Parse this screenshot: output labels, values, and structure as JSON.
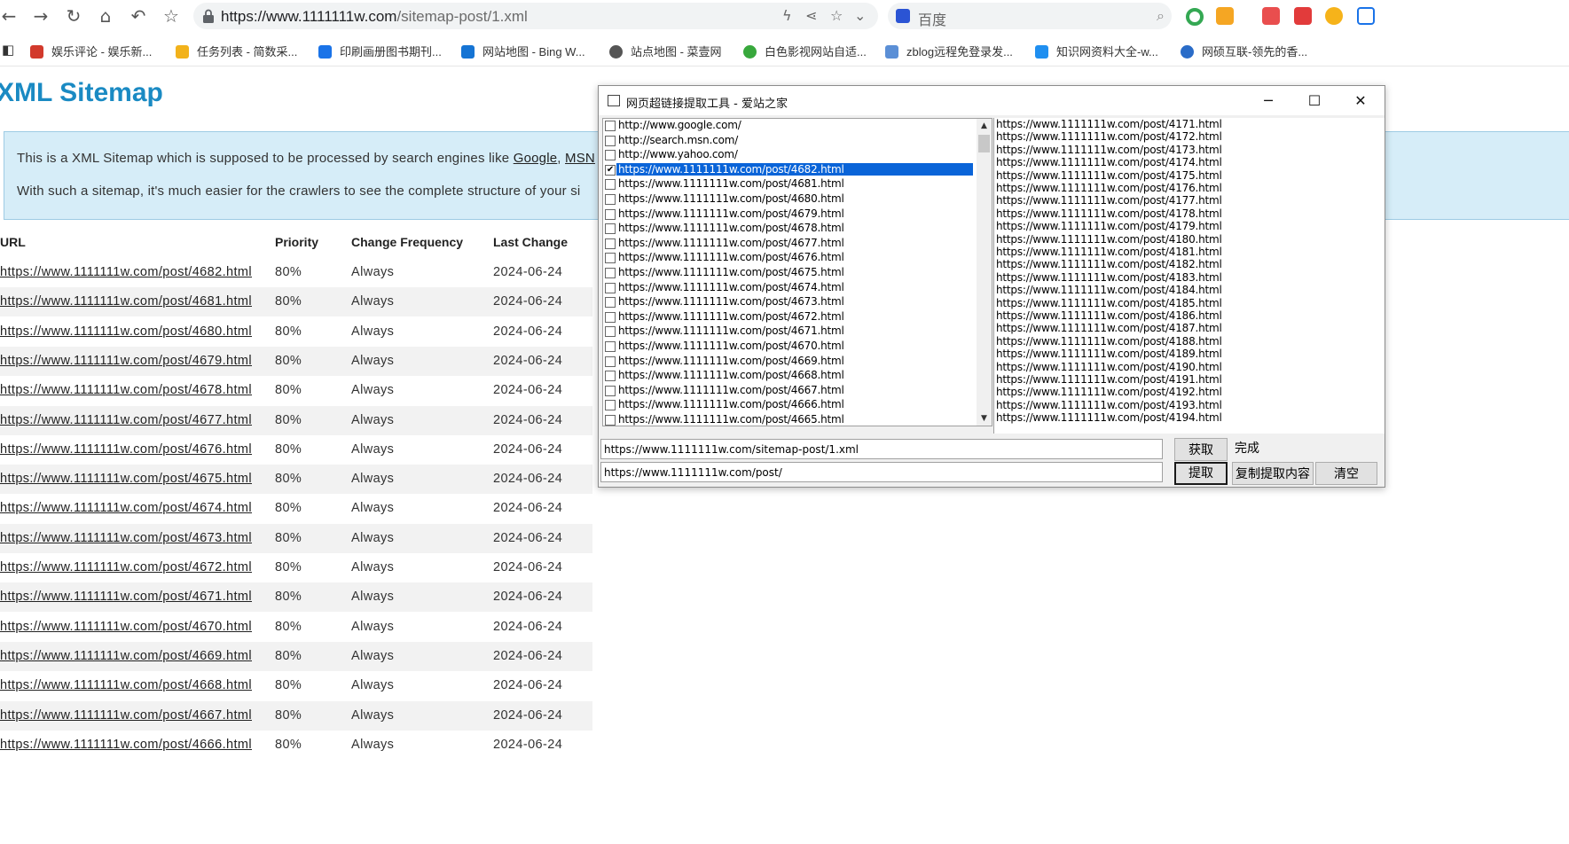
{
  "browser": {
    "url_host": "https://www.1111111w.com",
    "url_path": "/sitemap-post/1.xml",
    "search_placeholder": "百度",
    "bookmarks": [
      {
        "label": "娱乐评论 - 娱乐新...",
        "color": "#d23a2c"
      },
      {
        "label": "任务列表 - 简数采...",
        "color": "#f2b21b"
      },
      {
        "label": "印刷画册图书期刊...",
        "color": "#1a73e8"
      },
      {
        "label": "网站地图 - Bing W...",
        "color": "#1574d4"
      },
      {
        "label": "站点地图 - 菜壹网",
        "color": "#555555"
      },
      {
        "label": "白色影视网站自适...",
        "color": "#38a83c"
      },
      {
        "label": "zblog远程免登录发...",
        "color": "#5b8fd6"
      },
      {
        "label": "知识网资料大全-w...",
        "color": "#1f8ff0"
      },
      {
        "label": "网硕互联-领先的香...",
        "color": "#2a6cc8"
      }
    ]
  },
  "page": {
    "title": "XML Sitemap",
    "info_line1_pre": "This is a XML Sitemap which is supposed to be processed by search engines like ",
    "info_link1": "Google",
    "info_sep": ", ",
    "info_link2": "MSN",
    "info_line2": "With such a sitemap, it's much easier for the crawlers to see the complete structure of your si",
    "headers": {
      "url": "URL",
      "priority": "Priority",
      "freq": "Change Frequency",
      "last": "Last Change"
    },
    "rows": [
      {
        "url": "https://www.1111111w.com/post/4682.html",
        "priority": "80%",
        "freq": "Always",
        "date": "2024-06-24"
      },
      {
        "url": "https://www.1111111w.com/post/4681.html",
        "priority": "80%",
        "freq": "Always",
        "date": "2024-06-24"
      },
      {
        "url": "https://www.1111111w.com/post/4680.html",
        "priority": "80%",
        "freq": "Always",
        "date": "2024-06-24"
      },
      {
        "url": "https://www.1111111w.com/post/4679.html",
        "priority": "80%",
        "freq": "Always",
        "date": "2024-06-24"
      },
      {
        "url": "https://www.1111111w.com/post/4678.html",
        "priority": "80%",
        "freq": "Always",
        "date": "2024-06-24"
      },
      {
        "url": "https://www.1111111w.com/post/4677.html",
        "priority": "80%",
        "freq": "Always",
        "date": "2024-06-24"
      },
      {
        "url": "https://www.1111111w.com/post/4676.html",
        "priority": "80%",
        "freq": "Always",
        "date": "2024-06-24"
      },
      {
        "url": "https://www.1111111w.com/post/4675.html",
        "priority": "80%",
        "freq": "Always",
        "date": "2024-06-24"
      },
      {
        "url": "https://www.1111111w.com/post/4674.html",
        "priority": "80%",
        "freq": "Always",
        "date": "2024-06-24"
      },
      {
        "url": "https://www.1111111w.com/post/4673.html",
        "priority": "80%",
        "freq": "Always",
        "date": "2024-06-24"
      },
      {
        "url": "https://www.1111111w.com/post/4672.html",
        "priority": "80%",
        "freq": "Always",
        "date": "2024-06-24"
      },
      {
        "url": "https://www.1111111w.com/post/4671.html",
        "priority": "80%",
        "freq": "Always",
        "date": "2024-06-24"
      },
      {
        "url": "https://www.1111111w.com/post/4670.html",
        "priority": "80%",
        "freq": "Always",
        "date": "2024-06-24"
      },
      {
        "url": "https://www.1111111w.com/post/4669.html",
        "priority": "80%",
        "freq": "Always",
        "date": "2024-06-24"
      },
      {
        "url": "https://www.1111111w.com/post/4668.html",
        "priority": "80%",
        "freq": "Always",
        "date": "2024-06-24"
      },
      {
        "url": "https://www.1111111w.com/post/4667.html",
        "priority": "80%",
        "freq": "Always",
        "date": "2024-06-24"
      },
      {
        "url": "https://www.1111111w.com/post/4666.html",
        "priority": "80%",
        "freq": "Always",
        "date": "2024-06-24"
      }
    ]
  },
  "dialog": {
    "title": "网页超链接提取工具 - 爱站之家",
    "left_items": [
      {
        "text": "http://www.google.com/",
        "checked": false
      },
      {
        "text": "http://search.msn.com/",
        "checked": false
      },
      {
        "text": "http://www.yahoo.com/",
        "checked": false
      },
      {
        "text": "https://www.1111111w.com/post/4682.html",
        "checked": true
      },
      {
        "text": "https://www.1111111w.com/post/4681.html",
        "checked": false
      },
      {
        "text": "https://www.1111111w.com/post/4680.html",
        "checked": false
      },
      {
        "text": "https://www.1111111w.com/post/4679.html",
        "checked": false
      },
      {
        "text": "https://www.1111111w.com/post/4678.html",
        "checked": false
      },
      {
        "text": "https://www.1111111w.com/post/4677.html",
        "checked": false
      },
      {
        "text": "https://www.1111111w.com/post/4676.html",
        "checked": false
      },
      {
        "text": "https://www.1111111w.com/post/4675.html",
        "checked": false
      },
      {
        "text": "https://www.1111111w.com/post/4674.html",
        "checked": false
      },
      {
        "text": "https://www.1111111w.com/post/4673.html",
        "checked": false
      },
      {
        "text": "https://www.1111111w.com/post/4672.html",
        "checked": false
      },
      {
        "text": "https://www.1111111w.com/post/4671.html",
        "checked": false
      },
      {
        "text": "https://www.1111111w.com/post/4670.html",
        "checked": false
      },
      {
        "text": "https://www.1111111w.com/post/4669.html",
        "checked": false
      },
      {
        "text": "https://www.1111111w.com/post/4668.html",
        "checked": false
      },
      {
        "text": "https://www.1111111w.com/post/4667.html",
        "checked": false
      },
      {
        "text": "https://www.1111111w.com/post/4666.html",
        "checked": false
      },
      {
        "text": "https://www.1111111w.com/post/4665.html",
        "checked": false
      }
    ],
    "selected_index": 3,
    "right_items": [
      "https://www.1111111w.com/post/4171.html",
      "https://www.1111111w.com/post/4172.html",
      "https://www.1111111w.com/post/4173.html",
      "https://www.1111111w.com/post/4174.html",
      "https://www.1111111w.com/post/4175.html",
      "https://www.1111111w.com/post/4176.html",
      "https://www.1111111w.com/post/4177.html",
      "https://www.1111111w.com/post/4178.html",
      "https://www.1111111w.com/post/4179.html",
      "https://www.1111111w.com/post/4180.html",
      "https://www.1111111w.com/post/4181.html",
      "https://www.1111111w.com/post/4182.html",
      "https://www.1111111w.com/post/4183.html",
      "https://www.1111111w.com/post/4184.html",
      "https://www.1111111w.com/post/4185.html",
      "https://www.1111111w.com/post/4186.html",
      "https://www.1111111w.com/post/4187.html",
      "https://www.1111111w.com/post/4188.html",
      "https://www.1111111w.com/post/4189.html",
      "https://www.1111111w.com/post/4190.html",
      "https://www.1111111w.com/post/4191.html",
      "https://www.1111111w.com/post/4192.html",
      "https://www.1111111w.com/post/4193.html",
      "https://www.1111111w.com/post/4194.html"
    ],
    "url_input": "https://www.1111111w.com/sitemap-post/1.xml",
    "filter_input": "https://www.1111111w.com/post/",
    "fetch_label": "获取",
    "extract_label": "提取",
    "copy_label": "复制提取内容",
    "clear_label": "清空",
    "status": "完成"
  }
}
